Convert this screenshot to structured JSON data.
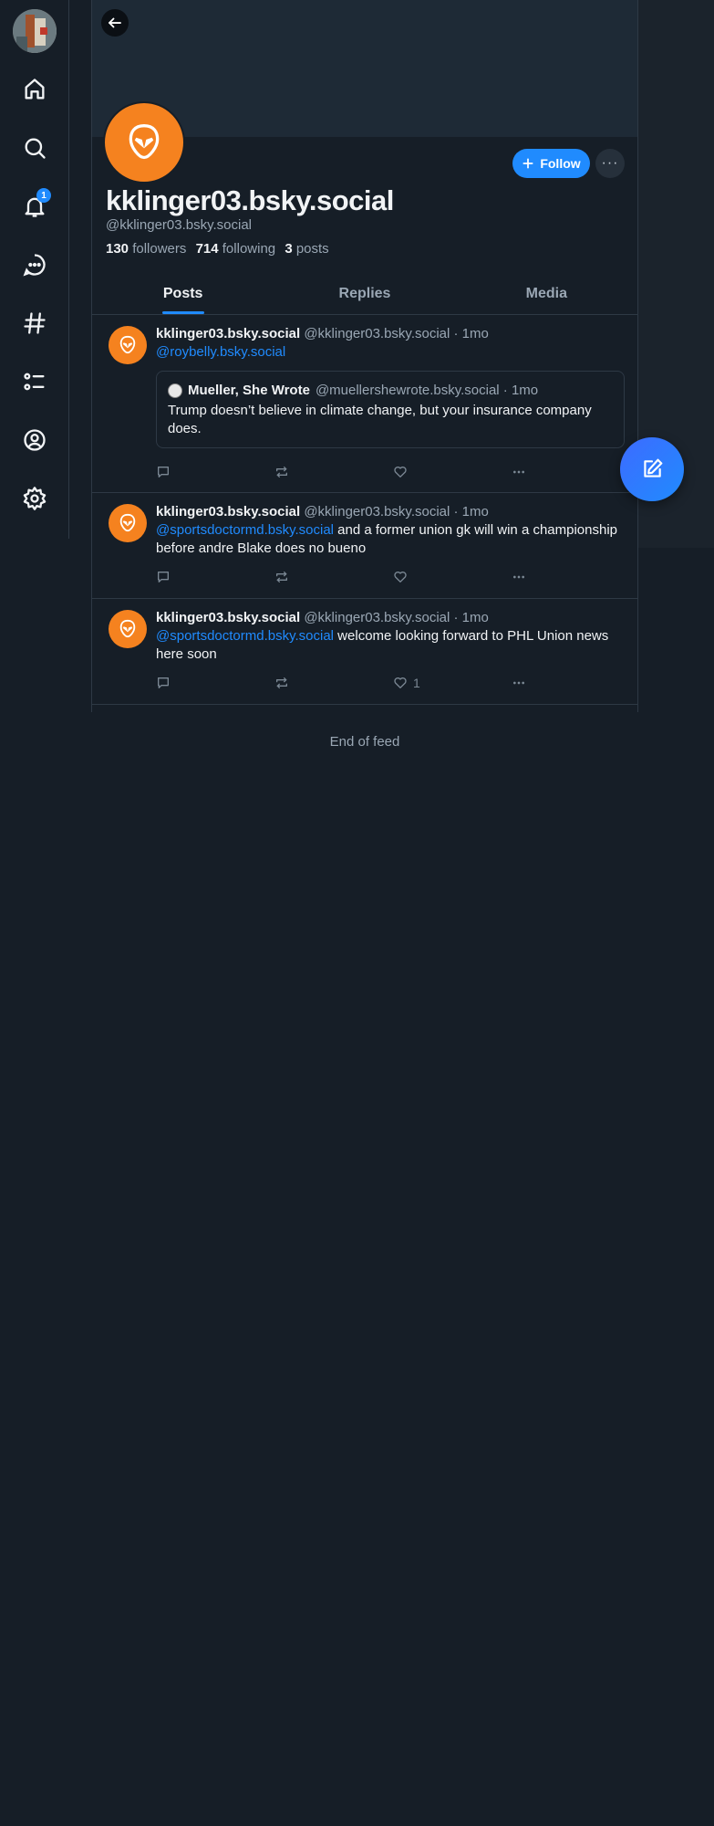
{
  "nav": {
    "items": [
      {
        "icon": "home-icon"
      },
      {
        "icon": "search-icon"
      },
      {
        "icon": "bell-icon",
        "badge": "1"
      },
      {
        "icon": "chat-icon"
      },
      {
        "icon": "hashtag-icon"
      },
      {
        "icon": "list-icon"
      },
      {
        "icon": "profile-icon"
      },
      {
        "icon": "gear-icon"
      }
    ]
  },
  "profile": {
    "display_name": "kklinger03.bsky.social",
    "handle": "@kklinger03.bsky.social",
    "followers_count": "130",
    "followers_label": "followers",
    "following_count": "714",
    "following_label": "following",
    "posts_count": "3",
    "posts_label": "posts",
    "follow_label": "Follow",
    "avatar_color": "#f5821f"
  },
  "tabs": [
    {
      "label": "Posts",
      "active": true
    },
    {
      "label": "Replies",
      "active": false
    },
    {
      "label": "Media",
      "active": false
    }
  ],
  "posts": [
    {
      "author": "kklinger03.bsky.social",
      "meta": "@kklinger03.bsky.social · 1mo",
      "mention": "@roybelly.bsky.social",
      "text": "",
      "quote": {
        "author": "Mueller, She Wrote",
        "meta": "@muellershewrote.bsky.social · 1mo",
        "text": "Trump doesn’t believe in climate change, but your insurance company does."
      },
      "like_count": ""
    },
    {
      "author": "kklinger03.bsky.social",
      "meta": "@kklinger03.bsky.social · 1mo",
      "mention": "@sportsdoctormd.bsky.social",
      "text": " and a former union gk will win a championship before andre Blake does no bueno",
      "like_count": ""
    },
    {
      "author": "kklinger03.bsky.social",
      "meta": "@kklinger03.bsky.social · 1mo",
      "mention": "@sportsdoctormd.bsky.social",
      "text": " welcome looking forward to PHL Union news here soon",
      "like_count": "1"
    }
  ],
  "feed": {
    "end_label": "End of feed"
  },
  "colors": {
    "accent": "#208bfe",
    "background": "#161e27",
    "avatar": "#f5821f"
  }
}
